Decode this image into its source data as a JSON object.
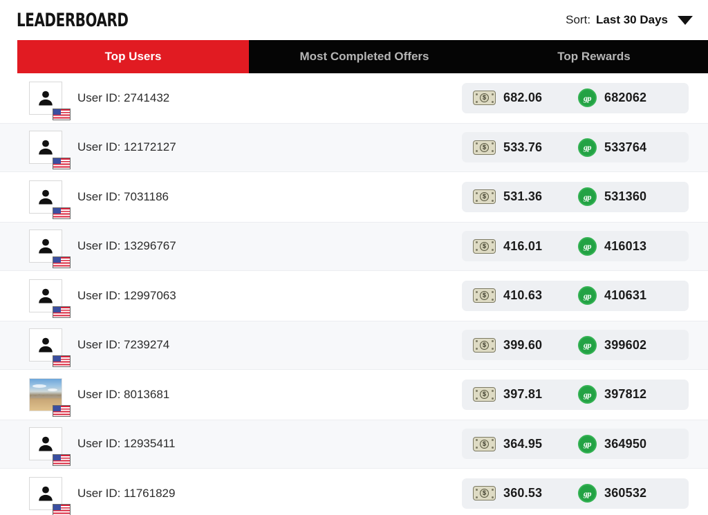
{
  "header": {
    "title": "LEADERBOARD",
    "sort_label": "Sort:",
    "sort_value": "Last 30 Days",
    "sort_caret_icon": "chevron-down-icon"
  },
  "tabs": [
    {
      "label": "Top Users",
      "active": true
    },
    {
      "label": "Most Completed Offers",
      "active": false
    },
    {
      "label": "Top Rewards",
      "active": false
    }
  ],
  "colors": {
    "accent_red": "#E11B22",
    "tabbar_black": "#050505",
    "row_alt": "#f7f8fa",
    "pill_bg": "#eef0f3",
    "coin_green": "#23a244"
  },
  "icons": {
    "cash": "dollar-bill-icon",
    "points": "gp-coin-icon",
    "flag": "us-flag-icon",
    "avatar_default": "person-avatar-icon"
  },
  "rows": [
    {
      "user_label": "User ID: 2741432",
      "cash": "682.06",
      "points": "682062",
      "avatar": "person",
      "flag": "us"
    },
    {
      "user_label": "User ID: 12172127",
      "cash": "533.76",
      "points": "533764",
      "avatar": "person",
      "flag": "us"
    },
    {
      "user_label": "User ID: 7031186",
      "cash": "531.36",
      "points": "531360",
      "avatar": "person",
      "flag": "us"
    },
    {
      "user_label": "User ID: 13296767",
      "cash": "416.01",
      "points": "416013",
      "avatar": "person",
      "flag": "us"
    },
    {
      "user_label": "User ID: 12997063",
      "cash": "410.63",
      "points": "410631",
      "avatar": "person",
      "flag": "us"
    },
    {
      "user_label": "User ID: 7239274",
      "cash": "399.60",
      "points": "399602",
      "avatar": "person",
      "flag": "us"
    },
    {
      "user_label": "User ID: 8013681",
      "cash": "397.81",
      "points": "397812",
      "avatar": "photo",
      "flag": "us"
    },
    {
      "user_label": "User ID: 12935411",
      "cash": "364.95",
      "points": "364950",
      "avatar": "person",
      "flag": "us"
    },
    {
      "user_label": "User ID: 11761829",
      "cash": "360.53",
      "points": "360532",
      "avatar": "person",
      "flag": "us"
    }
  ]
}
